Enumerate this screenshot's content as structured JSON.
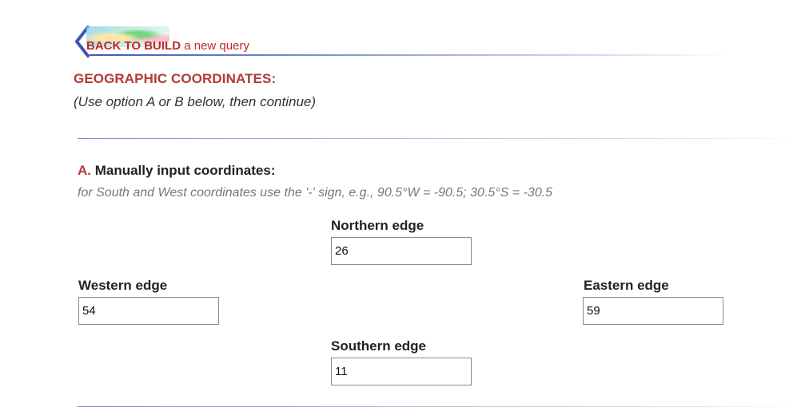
{
  "back_link": {
    "strong_text": "BACK TO BUILD",
    "rest_text": "a new query"
  },
  "section": {
    "title": "GEOGRAPHIC COORDINATES:",
    "instructions": "(Use option A or B below, then continue)"
  },
  "option_a": {
    "letter": "A.",
    "heading": "Manually input coordinates:",
    "hint": "for South and West coordinates use the '-' sign, e.g., 90.5°W = -90.5; 30.5°S = -30.5",
    "fields": {
      "northern": {
        "label": "Northern edge",
        "value": "26"
      },
      "western": {
        "label": "Western edge",
        "value": "54"
      },
      "eastern": {
        "label": "Eastern edge",
        "value": "59"
      },
      "southern": {
        "label": "Southern edge",
        "value": "11"
      }
    }
  },
  "colors": {
    "accent_red": "#b03a3a",
    "link_red": "#c1272d",
    "rule_blue": "#3f57b0"
  }
}
